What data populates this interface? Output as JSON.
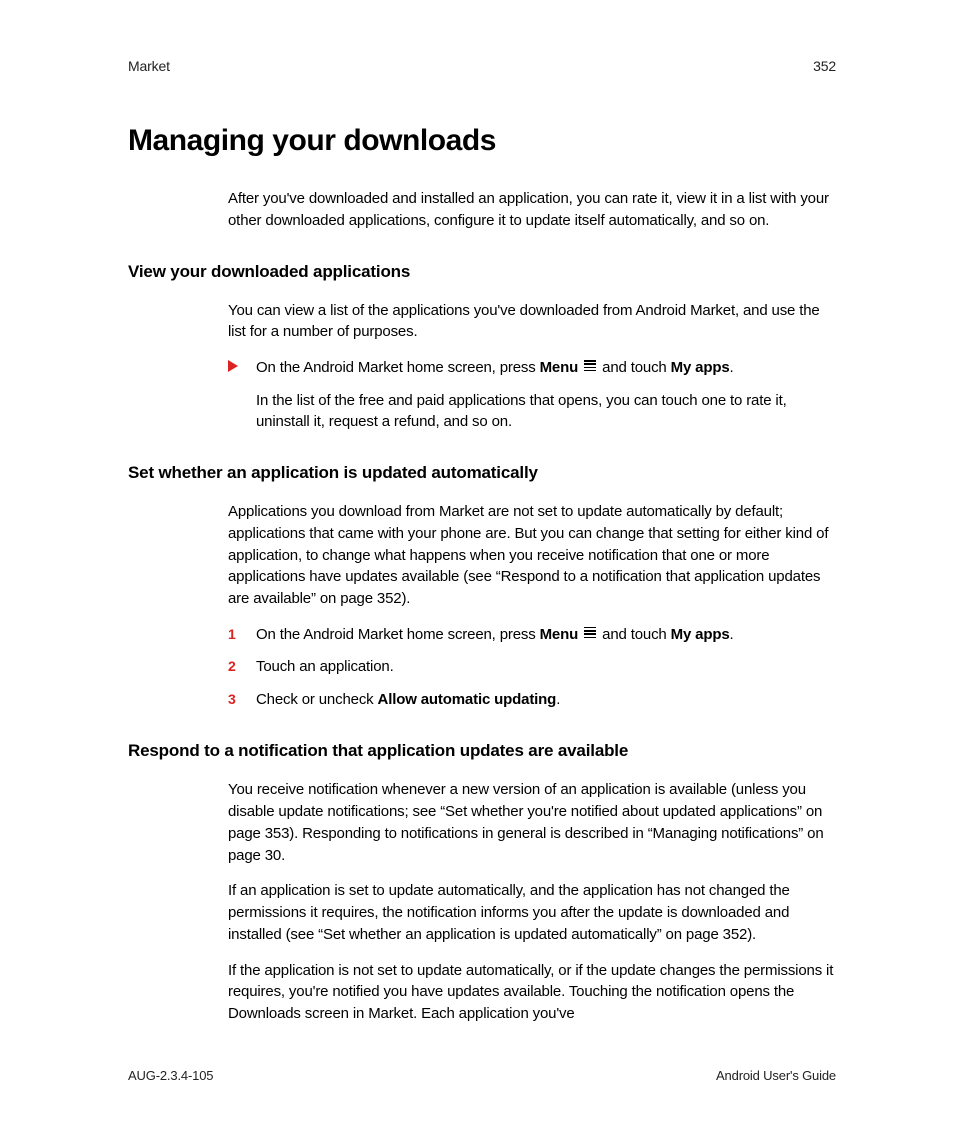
{
  "header": {
    "left": "Market",
    "right": "352"
  },
  "title": "Managing your downloads",
  "intro": "After you've downloaded and installed an application, you can rate it, view it in a list with your other downloaded applications, configure it to update itself automatically, and so on.",
  "section1": {
    "heading": "View your downloaded applications",
    "p1": "You can view a list of the applications you've downloaded from Android Market, and use the list for a number of purposes.",
    "bullet": {
      "pre": "On the Android Market home screen, press ",
      "menu": "Menu",
      "mid": " and touch ",
      "myapps": "My apps",
      "post": "."
    },
    "note": "In the list of the free and paid applications that opens, you can touch one to rate it, uninstall it, request a refund, and so on."
  },
  "section2": {
    "heading": "Set whether an application is updated automatically",
    "p1": "Applications you download from Market are not set to update automatically by default; applications that came with your phone are. But you can change that setting for either kind of application, to change what happens when you receive notification that one or more applications have updates available (see “Respond to a notification that application updates are available” on page 352).",
    "step1": {
      "pre": "On the Android Market home screen, press ",
      "menu": "Menu",
      "mid": " and touch ",
      "myapps": "My apps",
      "post": "."
    },
    "step2": "Touch an application.",
    "step3": {
      "pre": "Check or uncheck ",
      "bold": "Allow automatic updating",
      "post": "."
    },
    "nums": {
      "n1": "1",
      "n2": "2",
      "n3": "3"
    }
  },
  "section3": {
    "heading": "Respond to a notification that application updates are available",
    "p1": "You receive notification whenever a new version of an application is available (unless you disable update notifications; see “Set whether you're notified about updated applications” on page 353). Responding to notifications in general is described in “Managing notifications” on page 30.",
    "p2": "If an application is set to update automatically, and the application has not changed the permissions it requires, the notification informs you after the update is downloaded and installed (see “Set whether an application is updated automatically” on page 352).",
    "p3": "If the application is not set to update automatically, or if the update changes the permissions it requires, you're notified you have updates available. Touching the notification opens the Downloads screen in Market. Each application you've"
  },
  "footer": {
    "left": "AUG-2.3.4-105",
    "right": "Android User's Guide"
  }
}
